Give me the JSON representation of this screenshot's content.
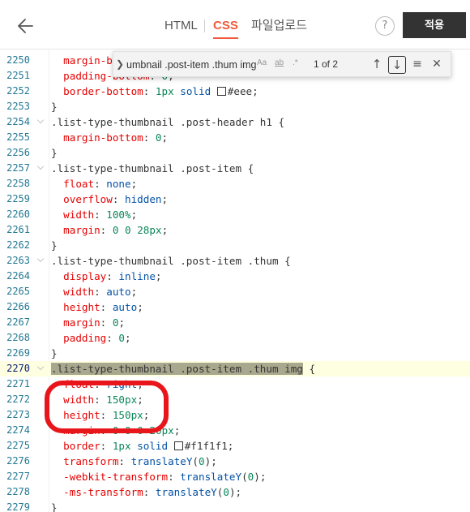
{
  "header": {
    "tabs": [
      {
        "label": "HTML",
        "active": false
      },
      {
        "label": "CSS",
        "active": true
      },
      {
        "label": "파일업로드",
        "active": false
      }
    ],
    "help_label": "?",
    "apply_label": "적용",
    "accent_color": "#ef5b3a"
  },
  "find": {
    "query": "umbnail .post-item .thum img",
    "case_label": "Aa",
    "word_label": "ab",
    "regex_label": ".*",
    "count": "1 of 2"
  },
  "editor": {
    "lines": [
      {
        "n": "2250",
        "fold": false,
        "code": "  margin-bottom: 0;"
      },
      {
        "n": "2251",
        "fold": false,
        "code": "  padding-bottom: 0;"
      },
      {
        "n": "2252",
        "fold": false,
        "code": "  border-bottom: 1px solid □#eee;"
      },
      {
        "n": "2253",
        "fold": false,
        "code": "}"
      },
      {
        "n": "2254",
        "fold": true,
        "code": ".list-type-thumbnail .post-header h1 {"
      },
      {
        "n": "2255",
        "fold": false,
        "code": "  margin-bottom: 0;"
      },
      {
        "n": "2256",
        "fold": false,
        "code": "}"
      },
      {
        "n": "2257",
        "fold": true,
        "code": ".list-type-thumbnail .post-item {"
      },
      {
        "n": "2258",
        "fold": false,
        "code": "  float: none;"
      },
      {
        "n": "2259",
        "fold": false,
        "code": "  overflow: hidden;"
      },
      {
        "n": "2260",
        "fold": false,
        "code": "  width: 100%;"
      },
      {
        "n": "2261",
        "fold": false,
        "code": "  margin: 0 0 28px;"
      },
      {
        "n": "2262",
        "fold": false,
        "code": "}"
      },
      {
        "n": "2263",
        "fold": true,
        "code": ".list-type-thumbnail .post-item .thum {"
      },
      {
        "n": "2264",
        "fold": false,
        "code": "  display: inline;"
      },
      {
        "n": "2265",
        "fold": false,
        "code": "  width: auto;"
      },
      {
        "n": "2266",
        "fold": false,
        "code": "  height: auto;"
      },
      {
        "n": "2267",
        "fold": false,
        "code": "  margin: 0;"
      },
      {
        "n": "2268",
        "fold": false,
        "code": "  padding: 0;"
      },
      {
        "n": "2269",
        "fold": false,
        "code": "}"
      },
      {
        "n": "2270",
        "fold": true,
        "code": ".list-type-thumbnail .post-item .thum img {",
        "active": true
      },
      {
        "n": "2271",
        "fold": false,
        "code": "  float: right;"
      },
      {
        "n": "2272",
        "fold": false,
        "code": "  width: 150px;"
      },
      {
        "n": "2273",
        "fold": false,
        "code": "  height: 150px;"
      },
      {
        "n": "2274",
        "fold": false,
        "code": "  margin: 0 0 0 20px;"
      },
      {
        "n": "2275",
        "fold": false,
        "code": "  border: 1px solid □#f1f1f1;"
      },
      {
        "n": "2276",
        "fold": false,
        "code": "  transform: translateY(0);"
      },
      {
        "n": "2277",
        "fold": false,
        "code": "  -webkit-transform: translateY(0);"
      },
      {
        "n": "2278",
        "fold": false,
        "code": "  -ms-transform: translateY(0);"
      },
      {
        "n": "2279",
        "fold": false,
        "code": "}"
      }
    ]
  },
  "colors": {
    "property": "#e50000",
    "value": "#0451a5",
    "number": "#098658",
    "line_number": "#237893",
    "annotation": "#e8151b"
  }
}
